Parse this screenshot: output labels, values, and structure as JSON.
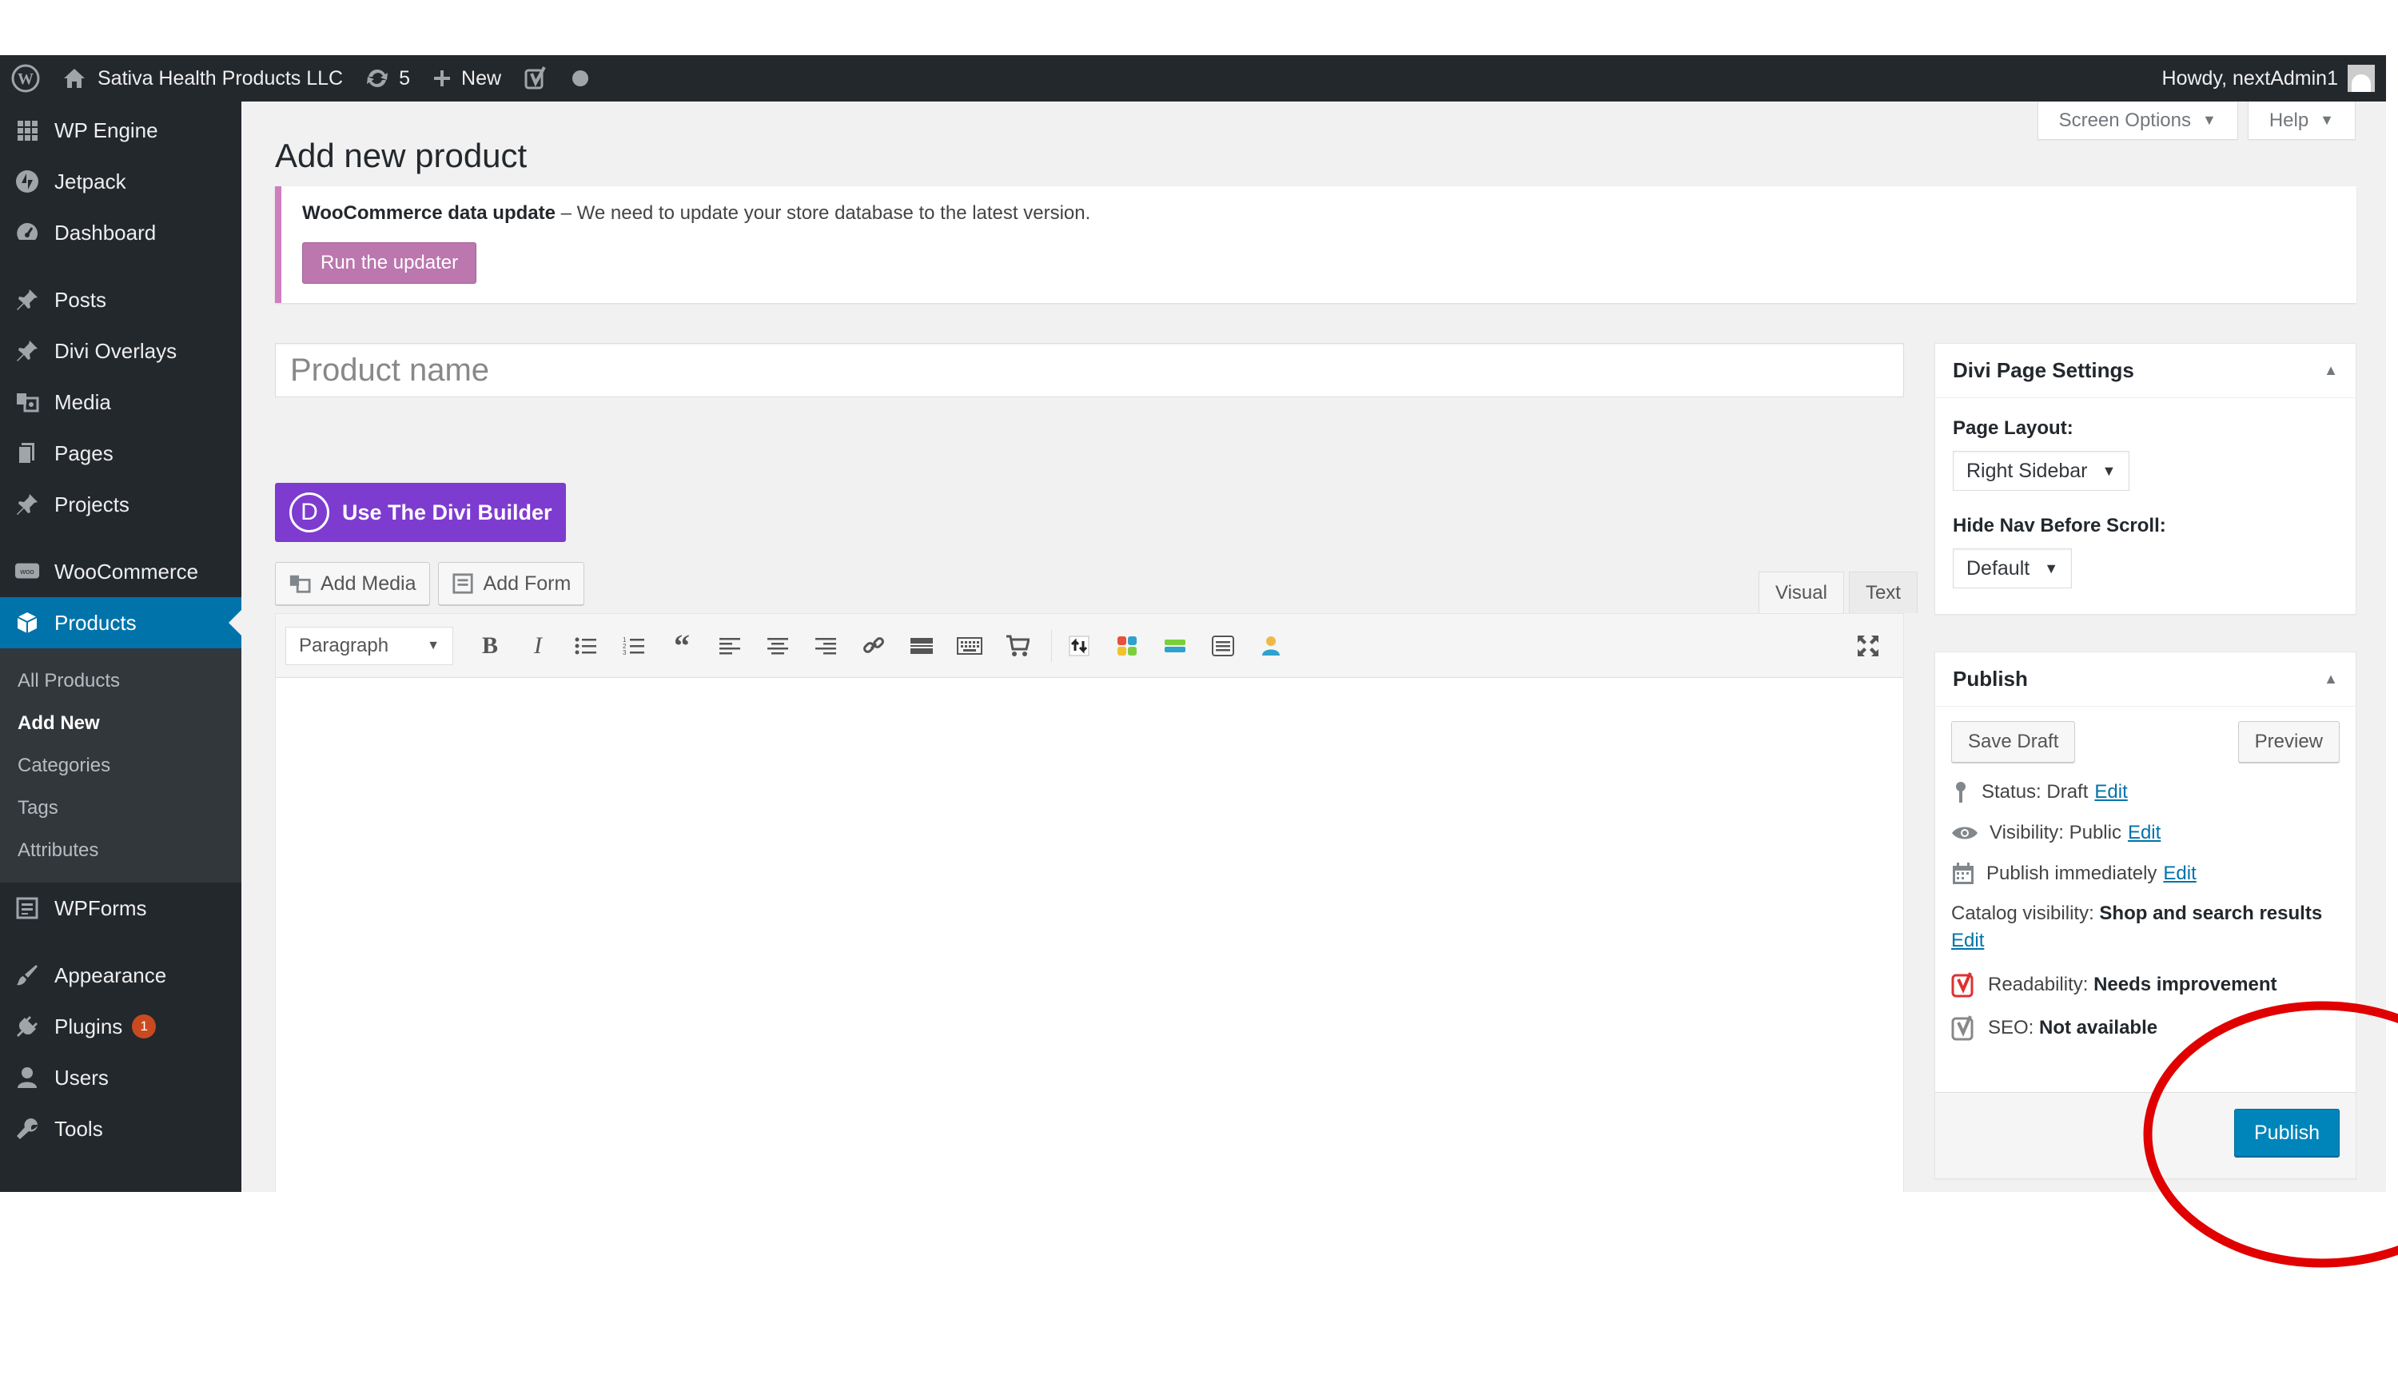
{
  "adminbar": {
    "site_name": "Sativa Health Products LLC",
    "updates_count": "5",
    "new_label": "New",
    "howdy": "Howdy, nextAdmin1"
  },
  "sidebar": {
    "items": [
      {
        "label": "WP Engine",
        "icon": "grid-icon"
      },
      {
        "label": "Jetpack",
        "icon": "jetpack-icon"
      },
      {
        "label": "Dashboard",
        "icon": "dashboard-icon"
      },
      {
        "label": "Posts",
        "icon": "pin-icon"
      },
      {
        "label": "Divi Overlays",
        "icon": "pin-icon"
      },
      {
        "label": "Media",
        "icon": "media-icon"
      },
      {
        "label": "Pages",
        "icon": "page-icon"
      },
      {
        "label": "Projects",
        "icon": "pin-icon"
      },
      {
        "label": "WooCommerce",
        "icon": "woo-icon"
      },
      {
        "label": "Products",
        "icon": "cube-icon"
      },
      {
        "label": "WPForms",
        "icon": "form-icon"
      },
      {
        "label": "Appearance",
        "icon": "brush-icon"
      },
      {
        "label": "Plugins",
        "icon": "plug-icon",
        "badge": "1"
      },
      {
        "label": "Users",
        "icon": "user-icon"
      },
      {
        "label": "Tools",
        "icon": "wrench-icon"
      }
    ],
    "submenu": [
      "All Products",
      "Add New",
      "Categories",
      "Tags",
      "Attributes"
    ]
  },
  "screen_meta": {
    "screen_options": "Screen Options",
    "help": "Help"
  },
  "page": {
    "title": "Add new product"
  },
  "notice": {
    "strong": "WooCommerce data update",
    "text": " – We need to update your store database to the latest version.",
    "button": "Run the updater"
  },
  "editor": {
    "title_placeholder": "Product name",
    "divi_label": "Use The Divi Builder",
    "divi_letter": "D",
    "add_media": "Add Media",
    "add_form": "Add Form",
    "tab_visual": "Visual",
    "tab_text": "Text",
    "format": "Paragraph"
  },
  "divi_settings": {
    "title": "Divi Page Settings",
    "layout_label": "Page Layout:",
    "layout_value": "Right Sidebar",
    "hidenav_label": "Hide Nav Before Scroll:",
    "hidenav_value": "Default"
  },
  "publish": {
    "title": "Publish",
    "save_draft": "Save Draft",
    "preview": "Preview",
    "status_label": "Status: Draft",
    "visibility_label": "Visibility: Public",
    "publish_immediately": "Publish immediately",
    "edit": "Edit",
    "catalog_label": "Catalog visibility:",
    "catalog_value": "Shop and search results",
    "readability_label": "Readability:",
    "readability_value": "Needs improvement",
    "seo_label": "SEO:",
    "seo_value": "Not available",
    "publish_button": "Publish"
  },
  "colors": {
    "accent": "#0073aa",
    "primary_button": "#0085ba",
    "divi_purple": "#7e3bd0",
    "woo_purple": "#bb77ae",
    "annotation_red": "#e00000"
  }
}
